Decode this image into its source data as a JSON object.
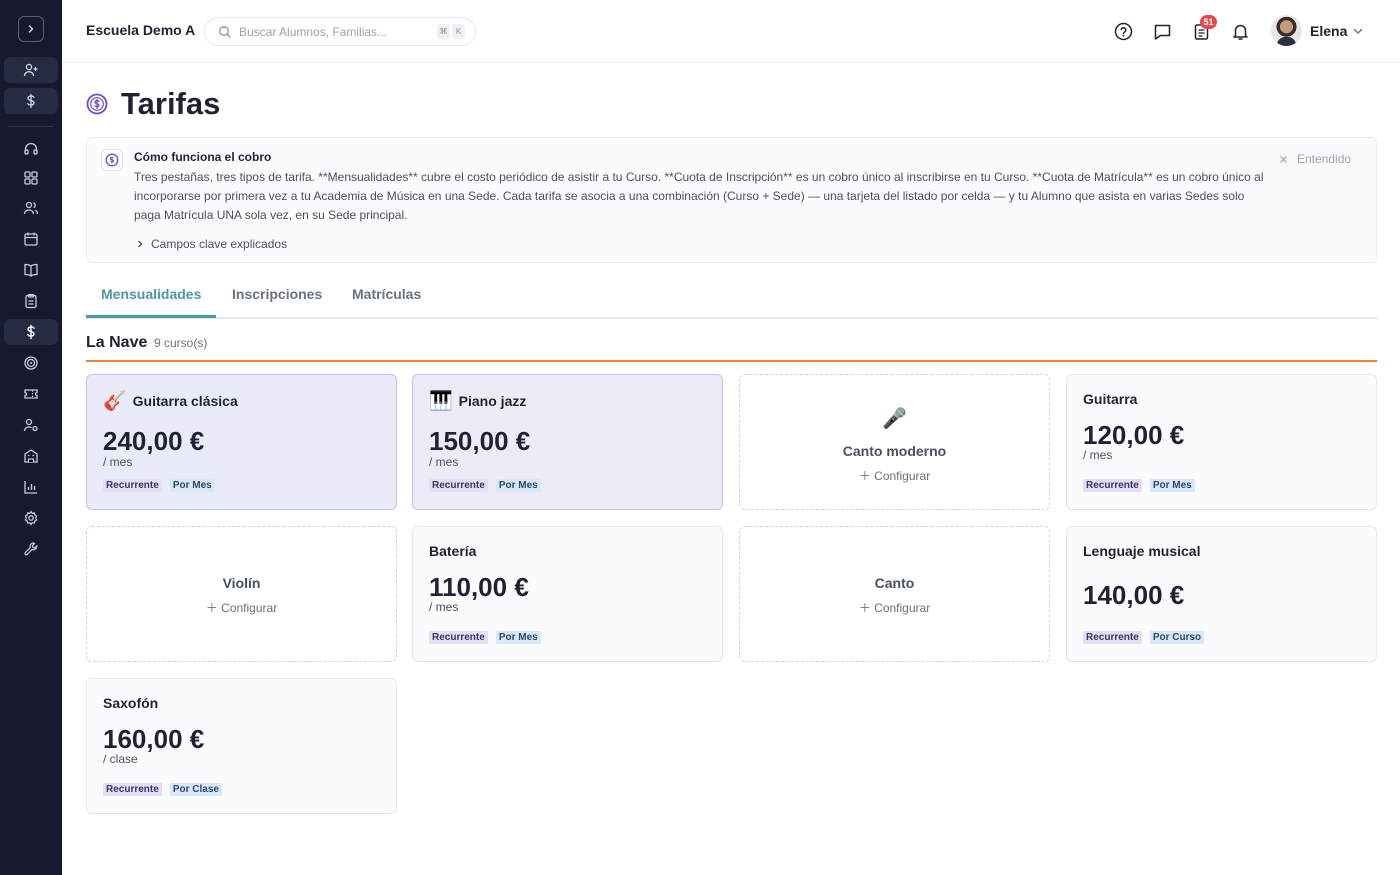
{
  "header": {
    "school_name": "Escuela Demo A",
    "search_placeholder": "Buscar Alumnos, Familias...",
    "shortcut_key1": "⌘",
    "shortcut_key2": "K",
    "notification_count": "51",
    "user_name": "Elena"
  },
  "page": {
    "title": "Tarifas"
  },
  "info": {
    "title": "Cómo funciona el cobro",
    "body": "Tres pestañas, tres tipos de tarifa. **Mensualidades** cubre el costo periódico de asistir a tu Curso. **Cuota de Inscripción** es un cobro único al inscribirse en tu Curso. **Cuota de Matrícula** es un cobro único al incorporarse por primera vez a tu Academia de Música en una Sede. Cada tarifa se asocia a una combinación (Curso + Sede) — una tarjeta del listado por celda — y tu Alumno que asista en varias Sedes solo paga Matrícula UNA sola vez, en su Sede principal.",
    "expand_label": "Campos clave explicados",
    "dismiss_label": "Entendido"
  },
  "tabs": [
    {
      "label": "Mensualidades",
      "active": true
    },
    {
      "label": "Inscripciones",
      "active": false
    },
    {
      "label": "Matrículas",
      "active": false
    }
  ],
  "section": {
    "title": "La Nave",
    "count": "9 curso(s)"
  },
  "cards": [
    {
      "name": "Guitarra clásica",
      "icon": "🎸",
      "price": "240,00 €",
      "unit": "/ mes",
      "tag1": "Recurrente",
      "tag2": "Por Mes"
    },
    {
      "name": "Piano jazz",
      "icon": "🎹",
      "price": "150,00 €",
      "unit": "/ mes",
      "tag1": "Recurrente",
      "tag2": "Por Mes"
    },
    {
      "name": "Canto moderno",
      "icon": "🎤",
      "config": "Configurar"
    },
    {
      "name": "Guitarra",
      "price": "120,00 €",
      "unit": "/ mes",
      "tag1": "Recurrente",
      "tag2": "Por Mes"
    },
    {
      "name": "Violín",
      "config": "Configurar"
    },
    {
      "name": "Batería",
      "price": "110,00 €",
      "unit": "/ mes",
      "tag1": "Recurrente",
      "tag2": "Por Mes"
    },
    {
      "name": "Canto",
      "config": "Configurar"
    },
    {
      "name": "Lenguaje musical",
      "price": "140,00 €",
      "tag1": "Recurrente",
      "tag2": "Por Curso"
    },
    {
      "name": "Saxofón",
      "price": "160,00 €",
      "unit": "/ clase",
      "tag1": "Recurrente",
      "tag2": "Por Clase"
    }
  ],
  "colors": {
    "sidebar_bg": "#171a2e",
    "accent_teal": "#4a9aa3",
    "section_line": "#e8853d",
    "icon_purple": "#6a4fc8"
  }
}
